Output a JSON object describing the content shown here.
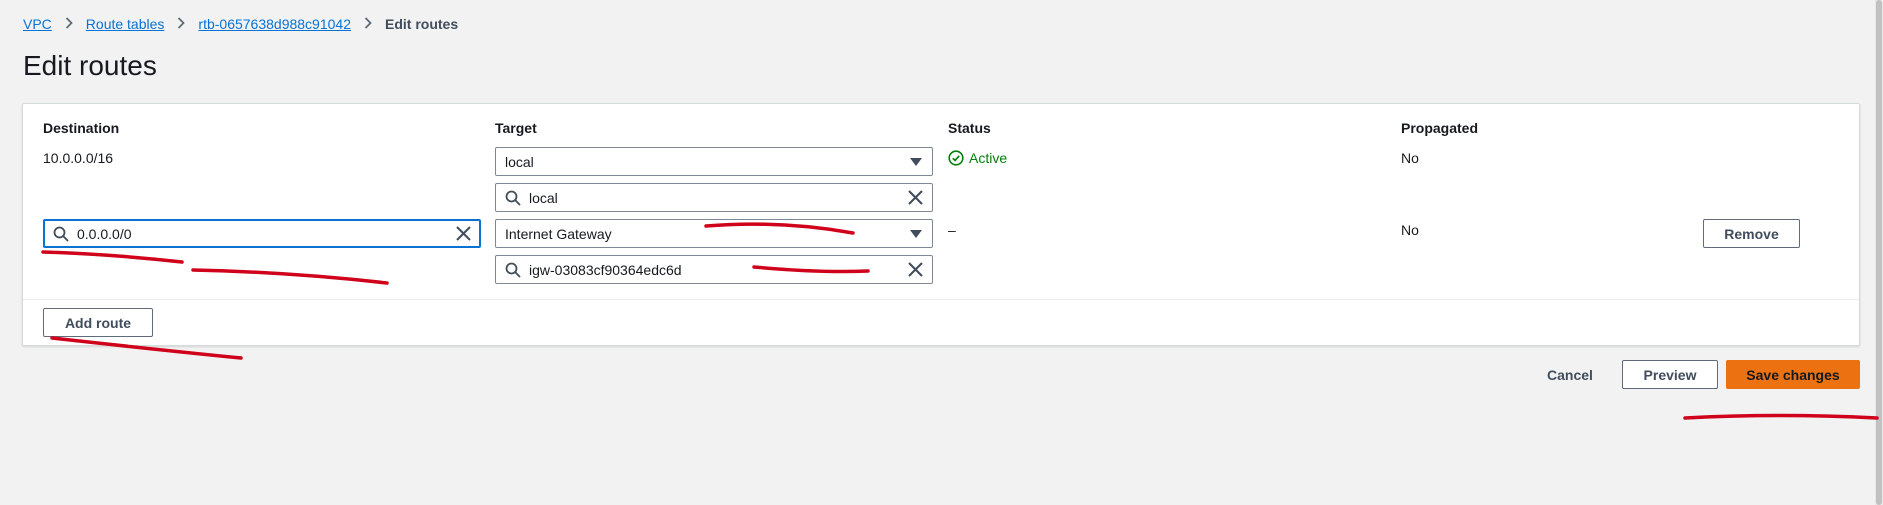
{
  "breadcrumb": {
    "items": [
      "VPC",
      "Route tables",
      "rtb-0657638d988c91042"
    ],
    "current": "Edit routes"
  },
  "page": {
    "title": "Edit routes"
  },
  "table": {
    "headers": {
      "destination": "Destination",
      "target": "Target",
      "status": "Status",
      "propagated": "Propagated"
    },
    "rows": [
      {
        "destination": "10.0.0.0/16",
        "target_select": "local",
        "target_search": "local",
        "status": "Active",
        "propagated": "No"
      },
      {
        "destination": "0.0.0.0/0",
        "target_select": "Internet Gateway",
        "target_search": "igw-03083cf90364edc6d",
        "status": "–",
        "propagated": "No",
        "remove_label": "Remove"
      }
    ],
    "add_route_label": "Add route"
  },
  "footer": {
    "cancel_label": "Cancel",
    "preview_label": "Preview",
    "save_label": "Save changes"
  },
  "icons": {
    "search": "search-icon",
    "clear": "close-icon",
    "caret": "caret-down-icon",
    "status": "status-check-icon"
  },
  "colors": {
    "link": "#0972d3",
    "status_success": "#037f0c",
    "primary": "#ec7211",
    "annotation": "#d0021b",
    "focus": "#0972d3"
  }
}
